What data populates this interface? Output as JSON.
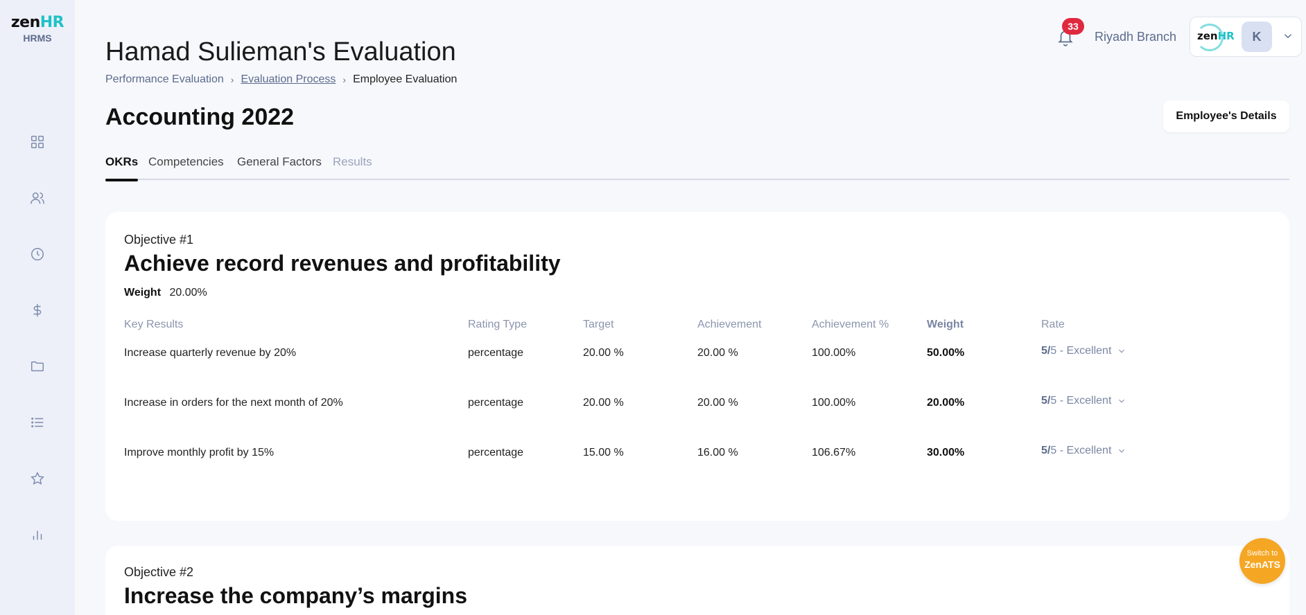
{
  "logo": {
    "word_main": "zen",
    "word_accent": "HR",
    "sub": "HRMS"
  },
  "sidebar": {
    "icons": [
      "grid-icon",
      "users-icon",
      "clock-icon",
      "dollar-icon",
      "folder-icon",
      "list-icon",
      "star-icon",
      "bar-chart-icon"
    ]
  },
  "header": {
    "title": "Hamad Sulieman's Evaluation",
    "breadcrumb": [
      "Performance Evaluation",
      "Evaluation Process",
      "Employee Evaluation"
    ],
    "notification_count": "33",
    "branch": "Riyadh Branch",
    "account_logo_main": "zen",
    "account_logo_accent": "HR",
    "avatar_initial": "K"
  },
  "evaluation": {
    "subtitle": "Accounting 2022",
    "details_button": "Employee's Details"
  },
  "tabs": [
    {
      "label": "OKRs",
      "active": true
    },
    {
      "label": "Competencies",
      "active": false
    },
    {
      "label": "General Factors",
      "active": false
    },
    {
      "label": "Results",
      "active": false
    }
  ],
  "objectives": [
    {
      "number": "Objective #1",
      "title": "Achieve record revenues and profitability",
      "weight_label": "Weight",
      "weight_value": "20.00%",
      "headers": [
        "Key Results",
        "Rating Type",
        "Target",
        "Achievement",
        "Achievement %",
        "Weight",
        "Rate"
      ],
      "rows": [
        {
          "key_result": "Increase quarterly revenue by 20%",
          "rating_type": "percentage",
          "target": "20.00 %",
          "achievement": "20.00 %",
          "achievement_pct": "100.00%",
          "weight": "50.00%",
          "rate_score": "5/",
          "rate_rest": "5 - Excellent"
        },
        {
          "key_result": "Increase in orders for the next month of 20%",
          "rating_type": "percentage",
          "target": "20.00 %",
          "achievement": "20.00 %",
          "achievement_pct": "100.00%",
          "weight": "20.00%",
          "rate_score": "5/",
          "rate_rest": "5 - Excellent"
        },
        {
          "key_result": "Improve monthly profit by 15%",
          "rating_type": "percentage",
          "target": "15.00 %",
          "achievement": "16.00 %",
          "achievement_pct": "106.67%",
          "weight": "30.00%",
          "rate_score": "5/",
          "rate_rest": "5 - Excellent"
        }
      ]
    },
    {
      "number": "Objective #2",
      "title": "Increase the company’s margins"
    }
  ],
  "switch_button": {
    "top": "Switch to",
    "main": "ZenATS"
  }
}
